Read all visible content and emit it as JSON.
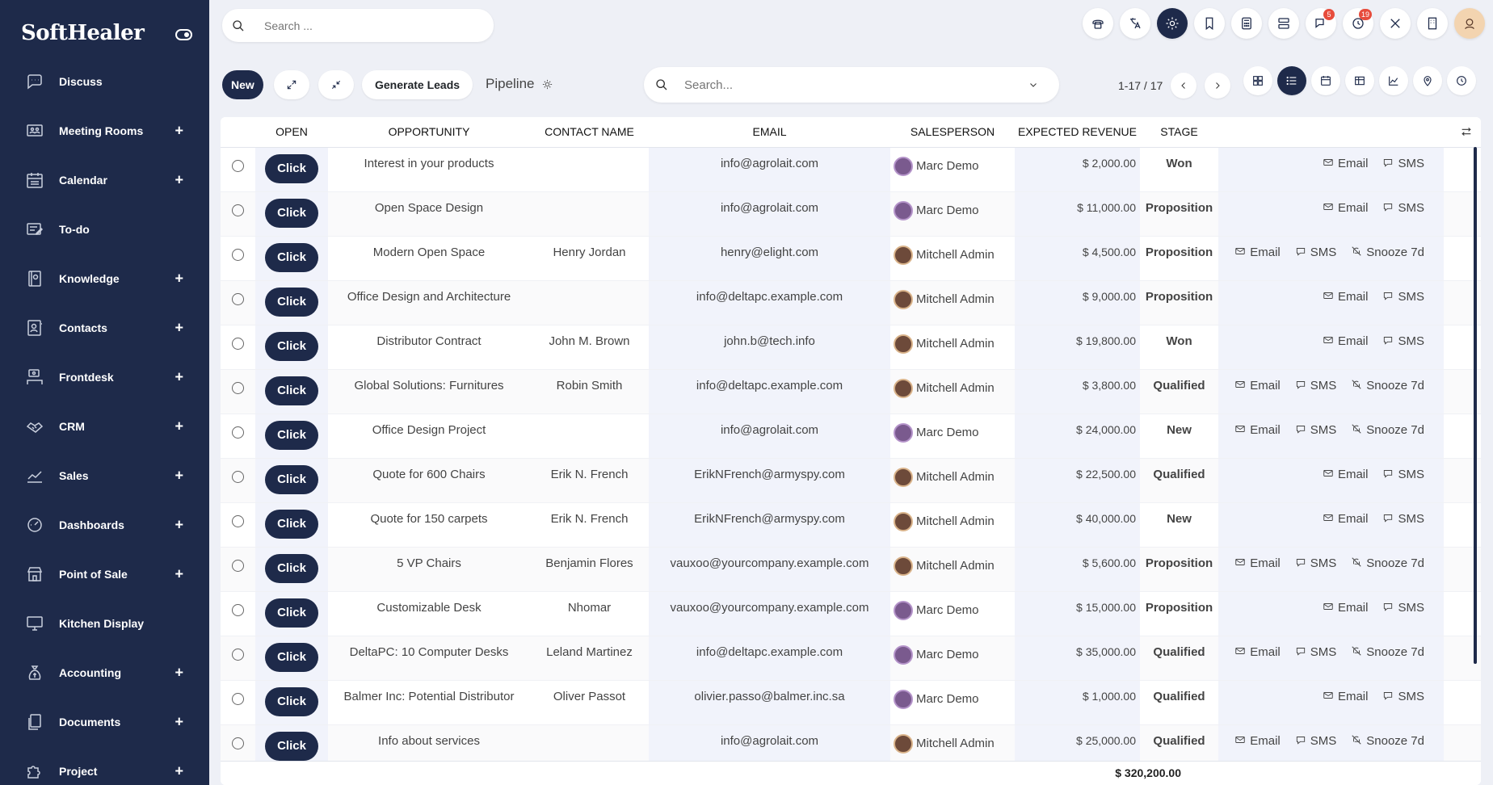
{
  "brand": "SoftHealer",
  "sidebar": {
    "items": [
      {
        "label": "Discuss",
        "icon": "chat-icon",
        "plus": false
      },
      {
        "label": "Meeting Rooms",
        "icon": "meeting-room-icon",
        "plus": true
      },
      {
        "label": "Calendar",
        "icon": "calendar-icon",
        "plus": true
      },
      {
        "label": "To-do",
        "icon": "todo-icon",
        "plus": false
      },
      {
        "label": "Knowledge",
        "icon": "book-icon",
        "plus": true
      },
      {
        "label": "Contacts",
        "icon": "contacts-icon",
        "plus": true
      },
      {
        "label": "Frontdesk",
        "icon": "frontdesk-icon",
        "plus": true
      },
      {
        "label": "CRM",
        "icon": "handshake-icon",
        "plus": true
      },
      {
        "label": "Sales",
        "icon": "chart-line-icon",
        "plus": true
      },
      {
        "label": "Dashboards",
        "icon": "gauge-icon",
        "plus": true
      },
      {
        "label": "Point of Sale",
        "icon": "store-icon",
        "plus": true
      },
      {
        "label": "Kitchen Display",
        "icon": "monitor-icon",
        "plus": false
      },
      {
        "label": "Accounting",
        "icon": "money-bag-icon",
        "plus": true
      },
      {
        "label": "Documents",
        "icon": "documents-icon",
        "plus": true
      },
      {
        "label": "Project",
        "icon": "puzzle-icon",
        "plus": true
      }
    ]
  },
  "topbar": {
    "search_placeholder": "Search ...",
    "badges": {
      "messages": "5",
      "activities": "19"
    }
  },
  "controls": {
    "new_label": "New",
    "generate_leads_label": "Generate Leads",
    "breadcrumb": "Pipeline",
    "search_placeholder": "Search...",
    "pager": "1-17 / 17"
  },
  "table": {
    "headers": {
      "open": "OPEN",
      "opportunity": "OPPORTUNITY",
      "contact": "CONTACT NAME",
      "email": "EMAIL",
      "salesperson": "SALESPERSON",
      "revenue": "EXPECTED REVENUE",
      "stage": "STAGE"
    },
    "click_label": "Click",
    "action_labels": {
      "email": "Email",
      "sms": "SMS",
      "snooze": "Snooze 7d"
    },
    "rows": [
      {
        "opportunity": "Interest in your products",
        "contact": "",
        "email": "info@agrolait.com",
        "salesperson": "Marc Demo",
        "avatar": "marc",
        "revenue": "$ 2,000.00",
        "stage": "Won",
        "snooze": false
      },
      {
        "opportunity": "Open Space Design",
        "contact": "",
        "email": "info@agrolait.com",
        "salesperson": "Marc Demo",
        "avatar": "marc",
        "revenue": "$ 11,000.00",
        "stage": "Proposition",
        "snooze": false
      },
      {
        "opportunity": "Modern Open Space",
        "contact": "Henry Jordan",
        "email": "henry@elight.com",
        "salesperson": "Mitchell Admin",
        "avatar": "mitch",
        "revenue": "$ 4,500.00",
        "stage": "Proposition",
        "snooze": true
      },
      {
        "opportunity": "Office Design and Architecture",
        "contact": "",
        "email": "info@deltapc.example.com",
        "salesperson": "Mitchell Admin",
        "avatar": "mitch",
        "revenue": "$ 9,000.00",
        "stage": "Proposition",
        "snooze": false
      },
      {
        "opportunity": "Distributor Contract",
        "contact": "John M. Brown",
        "email": "john.b@tech.info",
        "salesperson": "Mitchell Admin",
        "avatar": "mitch",
        "revenue": "$ 19,800.00",
        "stage": "Won",
        "snooze": false
      },
      {
        "opportunity": "Global Solutions: Furnitures",
        "contact": "Robin Smith",
        "email": "info@deltapc.example.com",
        "salesperson": "Mitchell Admin",
        "avatar": "mitch",
        "revenue": "$ 3,800.00",
        "stage": "Qualified",
        "snooze": true
      },
      {
        "opportunity": "Office Design Project",
        "contact": "",
        "email": "info@agrolait.com",
        "salesperson": "Marc Demo",
        "avatar": "marc",
        "revenue": "$ 24,000.00",
        "stage": "New",
        "snooze": true
      },
      {
        "opportunity": "Quote for 600 Chairs",
        "contact": "Erik N. French",
        "email": "ErikNFrench@armyspy.com",
        "salesperson": "Mitchell Admin",
        "avatar": "mitch",
        "revenue": "$ 22,500.00",
        "stage": "Qualified",
        "snooze": false
      },
      {
        "opportunity": "Quote for 150 carpets",
        "contact": "Erik N. French",
        "email": "ErikNFrench@armyspy.com",
        "salesperson": "Mitchell Admin",
        "avatar": "mitch",
        "revenue": "$ 40,000.00",
        "stage": "New",
        "snooze": false
      },
      {
        "opportunity": "5 VP Chairs",
        "contact": "Benjamin Flores",
        "email": "vauxoo@yourcompany.example.com",
        "salesperson": "Mitchell Admin",
        "avatar": "mitch",
        "revenue": "$ 5,600.00",
        "stage": "Proposition",
        "snooze": true
      },
      {
        "opportunity": "Customizable Desk",
        "contact": "Nhomar",
        "email": "vauxoo@yourcompany.example.com",
        "salesperson": "Marc Demo",
        "avatar": "marc",
        "revenue": "$ 15,000.00",
        "stage": "Proposition",
        "snooze": false
      },
      {
        "opportunity": "DeltaPC: 10 Computer Desks",
        "contact": "Leland Martinez",
        "email": "info@deltapc.example.com",
        "salesperson": "Marc Demo",
        "avatar": "marc",
        "revenue": "$ 35,000.00",
        "stage": "Qualified",
        "snooze": true
      },
      {
        "opportunity": "Balmer Inc: Potential Distributor",
        "contact": "Oliver Passot",
        "email": "olivier.passo@balmer.inc.sa",
        "salesperson": "Marc Demo",
        "avatar": "marc",
        "revenue": "$ 1,000.00",
        "stage": "Qualified",
        "snooze": false
      },
      {
        "opportunity": "Info about services",
        "contact": "",
        "email": "info@agrolait.com",
        "salesperson": "Mitchell Admin",
        "avatar": "mitch",
        "revenue": "$ 25,000.00",
        "stage": "Qualified",
        "snooze": true
      }
    ],
    "total": "$ 320,200.00"
  }
}
